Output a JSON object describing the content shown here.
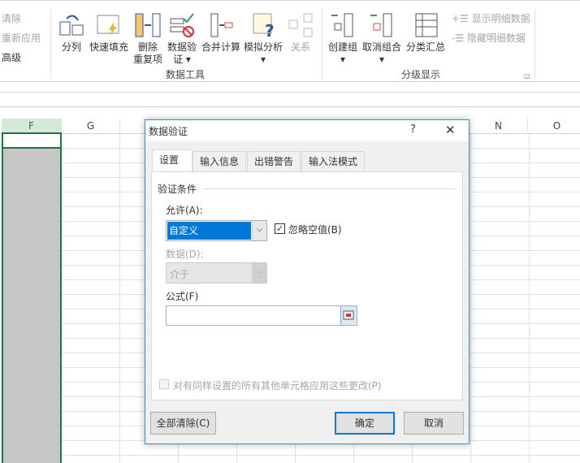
{
  "ribbon": {
    "sort_filter": {
      "clear": "清除",
      "reapply": "重新应用",
      "advanced": "高级"
    },
    "data_tools": {
      "label": "数据工具",
      "buttons": [
        {
          "label": "分列",
          "icon": "text-to-columns-icon"
        },
        {
          "label": "快速填充",
          "icon": "flash-fill-icon"
        },
        {
          "label": "删除重复项",
          "line1": "删除",
          "line2": "重复项",
          "icon": "remove-duplicates-icon"
        },
        {
          "label": "数据验证",
          "line1": "数据验",
          "line2": "证",
          "icon": "data-validation-icon"
        },
        {
          "label": "合并计算",
          "icon": "consolidate-icon"
        },
        {
          "label": "模拟分析",
          "icon": "what-if-icon"
        },
        {
          "label": "关系",
          "icon": "relationships-icon"
        }
      ]
    },
    "outline": {
      "label": "分级显示",
      "group": "创建组",
      "ungroup": "取消组合",
      "subtotal": "分类汇总",
      "show_detail": "显示明细数据",
      "hide_detail": "隐藏明细数据"
    }
  },
  "sheet": {
    "columns": [
      "F",
      "G",
      "N",
      "O"
    ],
    "selected_column": "F"
  },
  "dialog": {
    "title": "数据验证",
    "help": "?",
    "close": "✕",
    "tabs": [
      "设置",
      "输入信息",
      "出错警告",
      "输入法模式"
    ],
    "section": "验证条件",
    "allow_label": "允许(A):",
    "allow_value": "自定义",
    "ignore_blank": "忽略空值(B)",
    "ignore_blank_checked": true,
    "data_label": "数据(D):",
    "data_value": "介于",
    "formula_label": "公式(F)",
    "formula_value": "",
    "apply_all": "对有同样设置的所有其他单元格应用这些更改(P)",
    "clear_all": "全部清除(C)",
    "ok": "确定",
    "cancel": "取消"
  },
  "colors": {
    "accent": "#217346",
    "selection": "#0078d7"
  }
}
